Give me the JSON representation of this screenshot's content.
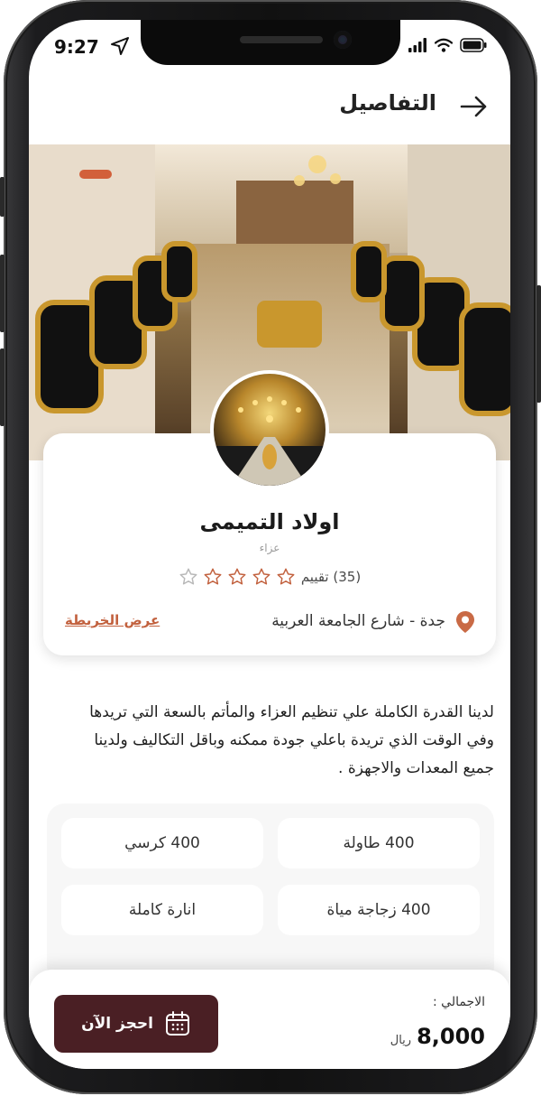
{
  "status_bar": {
    "time": "9:27"
  },
  "header": {
    "title": "التفاصيل",
    "back_icon": "arrow-right-icon"
  },
  "venue": {
    "name": "اولاد التميمى",
    "category": "عزاء",
    "rating_count": "(35) تقييم",
    "rating_stars": 0,
    "location": "جدة - شارع الجامعة العربية",
    "map_link": "عرض الخريطة"
  },
  "description": "لدينا القدرة الكاملة علي تنظيم العزاء والمأتم بالسعة التي تريدها وفي الوقت الذي تريدة باعلي جودة ممكنه وباقل التكاليف ولدينا جميع المعدات والاجهزة .",
  "features": [
    {
      "label": "400 طاولة"
    },
    {
      "label": "400 كرسي"
    },
    {
      "label": "400 زجاجة مياة"
    },
    {
      "label": "انارة كاملة"
    }
  ],
  "footer": {
    "total_label": "الاجمالي :",
    "total_value": "8,000",
    "currency": "ريال",
    "book_label": "احجز الآن",
    "book_icon": "calendar-icon"
  },
  "colors": {
    "accent": "#c2613e",
    "button": "#4a1f24",
    "pin": "#c96a45"
  }
}
